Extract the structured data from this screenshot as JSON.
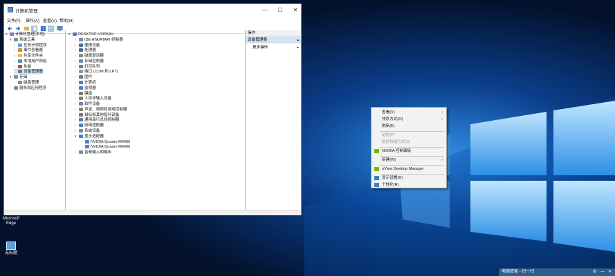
{
  "window": {
    "title": "计算机管理",
    "controls": {
      "minimize": "—",
      "maximize": "☐",
      "close": "✕"
    }
  },
  "menubar": [
    "文件(F)",
    "操作(A)",
    "查看(V)",
    "帮助(H)"
  ],
  "left_tree": [
    {
      "label": "计算机管理(本地)",
      "level": 0,
      "exp": "▾",
      "color": "#6d8fb5"
    },
    {
      "label": "系统工具",
      "level": 1,
      "exp": "▾",
      "color": "#8c8c8c"
    },
    {
      "label": "任务计划程序",
      "level": 2,
      "exp": "›",
      "color": "#6a9ad6"
    },
    {
      "label": "事件查看器",
      "level": 2,
      "exp": "›",
      "color": "#c98a3a"
    },
    {
      "label": "共享文件夹",
      "level": 2,
      "exp": "›",
      "color": "#e6b84a"
    },
    {
      "label": "本地用户和组",
      "level": 2,
      "exp": "›",
      "color": "#5a87c8"
    },
    {
      "label": "性能",
      "level": 2,
      "exp": "›",
      "color": "#b04a4a"
    },
    {
      "label": "设备管理器",
      "level": 2,
      "exp": "",
      "color": "#6f7c8c",
      "selected": true
    },
    {
      "label": "存储",
      "level": 1,
      "exp": "▾",
      "color": "#8c8c8c"
    },
    {
      "label": "磁盘管理",
      "level": 2,
      "exp": "",
      "color": "#6f8fb0"
    },
    {
      "label": "服务和应用程序",
      "level": 1,
      "exp": "›",
      "color": "#7c8fa0"
    }
  ],
  "device_tree": [
    {
      "label": "DESKTOP-V3ID54V",
      "level": 0,
      "exp": "▾",
      "color": "#5a7fae"
    },
    {
      "label": "IDE ATA/ATAPI 控制器",
      "level": 1,
      "exp": "›",
      "color": "#7d8a97"
    },
    {
      "label": "便携设备",
      "level": 1,
      "exp": "›",
      "color": "#4f6f95"
    },
    {
      "label": "处理器",
      "level": 1,
      "exp": "›",
      "color": "#4a6a8a"
    },
    {
      "label": "磁盘驱动器",
      "level": 1,
      "exp": "›",
      "color": "#8a8a8a"
    },
    {
      "label": "存储控制器",
      "level": 1,
      "exp": "›",
      "color": "#6f8a9f"
    },
    {
      "label": "打印队列",
      "level": 1,
      "exp": "›",
      "color": "#7a7a7a"
    },
    {
      "label": "端口 (COM 和 LPT)",
      "level": 1,
      "exp": "›",
      "color": "#8a9aa8"
    },
    {
      "label": "固件",
      "level": 1,
      "exp": "›",
      "color": "#6a7a8a"
    },
    {
      "label": "计算机",
      "level": 1,
      "exp": "›",
      "color": "#4f7fbf"
    },
    {
      "label": "监视器",
      "level": 1,
      "exp": "›",
      "color": "#4f7fbf"
    },
    {
      "label": "键盘",
      "level": 1,
      "exp": "›",
      "color": "#7a7a7a"
    },
    {
      "label": "人体学输入设备",
      "level": 1,
      "exp": "›",
      "color": "#8a7a6a"
    },
    {
      "label": "软件设备",
      "level": 1,
      "exp": "›",
      "color": "#6f8a9f"
    },
    {
      "label": "声音、视频和游戏控制器",
      "level": 1,
      "exp": "›",
      "color": "#7a8a6a"
    },
    {
      "label": "鼠标和其他指针设备",
      "level": 1,
      "exp": "›",
      "color": "#7a7a7a"
    },
    {
      "label": "通用串行总线控制器",
      "level": 1,
      "exp": "›",
      "color": "#6a7a9a"
    },
    {
      "label": "网络适配器",
      "level": 1,
      "exp": "›",
      "color": "#4f7fbf"
    },
    {
      "label": "系统设备",
      "level": 1,
      "exp": "›",
      "color": "#6a8aaa"
    },
    {
      "label": "显示适配器",
      "level": 1,
      "exp": "▾",
      "color": "#4f7fbf"
    },
    {
      "label": "NVIDIA Quadro M4000",
      "level": 2,
      "exp": "",
      "color": "#4f7fbf"
    },
    {
      "label": "NVIDIA Quadro M4000",
      "level": 2,
      "exp": "",
      "color": "#4f7fbf"
    },
    {
      "label": "音频输入和输出",
      "level": 1,
      "exp": "›",
      "color": "#7a8a9a"
    }
  ],
  "actions": {
    "title": "操作",
    "section": "设备管理器",
    "more": "更多操作"
  },
  "context_menu": [
    {
      "label": "查看(V)",
      "arrow": "›",
      "disabled": false
    },
    {
      "label": "排序方式(O)",
      "arrow": "›",
      "disabled": false
    },
    {
      "label": "刷新(E)",
      "arrow": "",
      "disabled": false
    },
    {
      "sep": true
    },
    {
      "label": "粘贴(P)",
      "arrow": "",
      "disabled": true
    },
    {
      "label": "粘贴快捷方式(S)",
      "arrow": "",
      "disabled": true
    },
    {
      "sep": true
    },
    {
      "label": "NVIDIA 控制面板",
      "arrow": "",
      "disabled": false,
      "icon": "nvidia-icon",
      "icon_color": "#76b900"
    },
    {
      "sep": true
    },
    {
      "label": "新建(W)",
      "arrow": "›",
      "disabled": false
    },
    {
      "sep": true
    },
    {
      "label": "nView Desktop Manager",
      "arrow": "",
      "disabled": false,
      "icon": "nvidia-icon",
      "icon_color": "#76b900"
    },
    {
      "sep": true
    },
    {
      "label": "显示设置(D)",
      "arrow": "",
      "disabled": false,
      "icon": "display-icon",
      "icon_color": "#3a7fd0"
    },
    {
      "label": "个性化(R)",
      "arrow": "",
      "disabled": false,
      "icon": "personalize-icon",
      "icon_color": "#3a7fd0"
    }
  ],
  "desktop_icons": [
    {
      "label": "Microsoft Edge"
    },
    {
      "label": "无标题"
    }
  ],
  "notification": {
    "text": "电脑管家 - 扫一扫",
    "settings": "⚙",
    "minimize": "—",
    "close": "✕"
  }
}
